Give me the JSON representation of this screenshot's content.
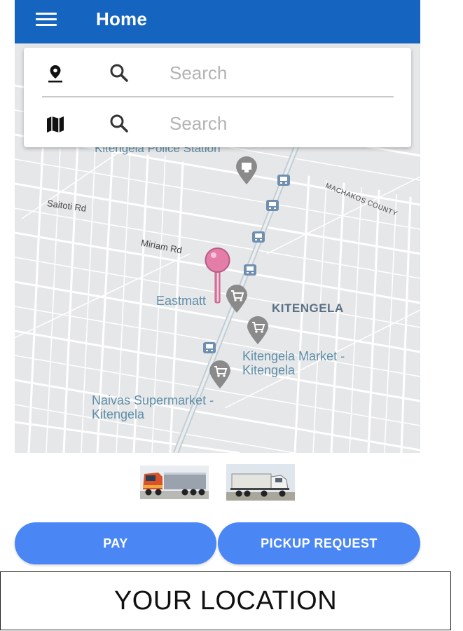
{
  "app_bar": {
    "title": "Home",
    "menu_icon": "hamburger-menu-icon",
    "background_color": "#1565c0"
  },
  "search": {
    "pickup": {
      "icon": "location-pin-icon",
      "search_icon": "search-icon",
      "placeholder": "Search",
      "value": ""
    },
    "destination": {
      "icon": "map-icon",
      "search_icon": "search-icon",
      "placeholder": "Search",
      "value": ""
    }
  },
  "map": {
    "streets": [
      "Saitoti Rd",
      "Miriam Rd",
      "MACHAKOS COUNTY"
    ],
    "places": [
      {
        "name": "Kitengela Police Station",
        "icon": "police-pin-icon"
      },
      {
        "name": "Eastmatt",
        "icon": "shopping-cart-pin-icon"
      },
      {
        "name": "Kitengela Market - Kitengela",
        "icon": "shopping-cart-pin-icon"
      },
      {
        "name": "Naivas Supermarket - Kitengela",
        "icon": "shopping-cart-pin-icon"
      }
    ],
    "area": "KITENGELA",
    "user_marker_icon": "location-marker-icon",
    "transit_icon": "bus-stop-icon",
    "marker_color": "#e47ea8"
  },
  "vehicles": [
    {
      "name": "truck-thumbnail-red",
      "icon": "truck-icon"
    },
    {
      "name": "truck-thumbnail-white",
      "icon": "truck-icon"
    }
  ],
  "actions": {
    "pay_label": "PAY",
    "pickup_label": "PICKUP REQUEST",
    "button_color": "#4a87f5"
  },
  "caption": "YOUR LOCATION"
}
